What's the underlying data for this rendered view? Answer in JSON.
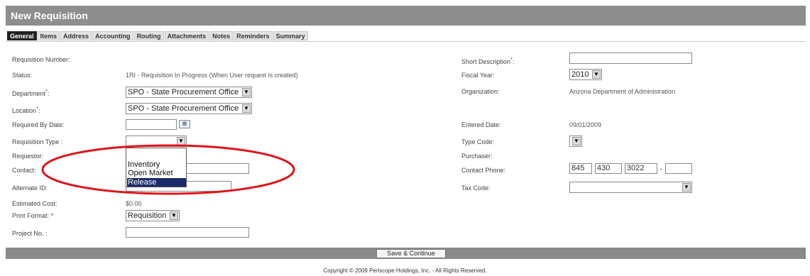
{
  "title": "New Requisition",
  "tabs": [
    "General",
    "Items",
    "Address",
    "Accounting",
    "Routing",
    "Attachments",
    "Notes",
    "Reminders",
    "Summary"
  ],
  "left": {
    "requisition_number_label": "Requisition Number:",
    "status_label": "Status:",
    "status_value": "1RI - Requisition In Progress (When User request is created)",
    "department_label": "Department",
    "department_value": "SPO - State Procurement Office",
    "location_label": "Location",
    "location_value": "SPO - State Procurement Office",
    "required_by_label": "Required By Date:",
    "req_type_label": "Requisition Type :",
    "requestor_label": "Requestor:",
    "contact_label": "Contact:",
    "alternate_id_label": "Alternate ID:",
    "estimated_cost_label": "Estimated Cost:",
    "estimated_cost_value": "$0.00",
    "print_format_label": "Print Format: *",
    "print_format_value": "Requisition",
    "project_no_label": "Project No. :"
  },
  "dropdown_options": [
    "Inventory",
    "Open Market",
    "Release"
  ],
  "right": {
    "short_desc_label": "Short Description",
    "fiscal_year_label": "Fiscal Year:",
    "fiscal_year_value": "2010",
    "organization_label": "Organization:",
    "organization_value": "Arizona Department of Administration",
    "entered_date_label": "Entered Date:",
    "entered_date_value": "09/01/2009",
    "type_code_label": "Type Code:",
    "purchaser_label": "Purchaser:",
    "contact_phone_label": "Contact Phone:",
    "phone_area": "845",
    "phone_prefix": "430",
    "phone_line": "3022",
    "tax_code_label": "Tax Code:"
  },
  "footer": {
    "save_label": "Save & Continue",
    "copyright": "Copyright © 2009 Periscope Holdings, Inc. - All Rights Reserved."
  },
  "colors": {
    "titlebar": "#8e8e8e",
    "annotation": "#e0141a",
    "selected_option": "#1b2a6b"
  }
}
